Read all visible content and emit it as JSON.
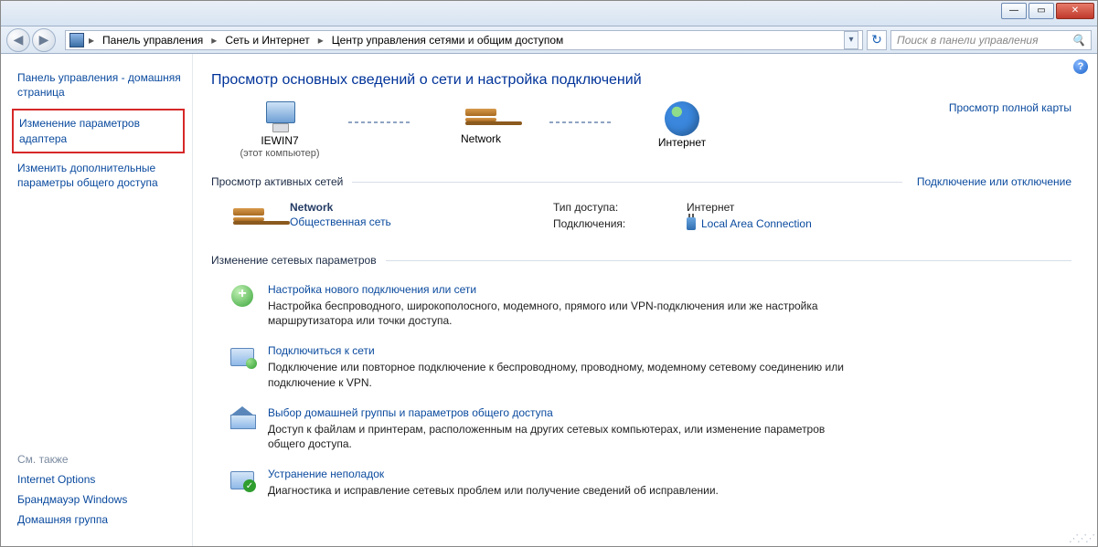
{
  "window": {
    "minimize": "—",
    "maximize": "▭",
    "close": "✕"
  },
  "breadcrumb": {
    "items": [
      "Панель управления",
      "Сеть и Интернет",
      "Центр управления сетями и общим доступом"
    ],
    "sep": "▸"
  },
  "search": {
    "placeholder": "Поиск в панели управления"
  },
  "sidebar": {
    "home": "Панель управления - домашняя страница",
    "adapter": "Изменение параметров адаптера",
    "advanced": "Изменить дополнительные параметры общего доступа"
  },
  "see_also": {
    "header": "См. также",
    "links": [
      "Internet Options",
      "Брандмауэр Windows",
      "Домашняя группа"
    ]
  },
  "main": {
    "title": "Просмотр основных сведений о сети и настройка подключений",
    "map": {
      "node1": "IEWIN7",
      "node1_sub": "(этот компьютер)",
      "node2": "Network",
      "node3": "Интернет",
      "full_map": "Просмотр полной карты"
    },
    "active_hdr": "Просмотр активных сетей",
    "active_link": "Подключение или отключение",
    "net": {
      "name": "Network",
      "type": "Общественная сеть",
      "access_lbl": "Тип доступа:",
      "access_val": "Интернет",
      "conn_lbl": "Подключения:",
      "conn_val": "Local Area Connection"
    },
    "change_hdr": "Изменение сетевых параметров",
    "opts": [
      {
        "title": "Настройка нового подключения или сети",
        "desc": "Настройка беспроводного, широкополосного, модемного, прямого или VPN-подключения или же настройка маршрутизатора или точки доступа."
      },
      {
        "title": "Подключиться к сети",
        "desc": "Подключение или повторное подключение к беспроводному, проводному, модемному сетевому соединению или подключение к VPN."
      },
      {
        "title": "Выбор домашней группы и параметров общего доступа",
        "desc": "Доступ к файлам и принтерам, расположенным на других сетевых компьютерах, или изменение параметров общего доступа."
      },
      {
        "title": "Устранение неполадок",
        "desc": "Диагностика и исправление сетевых проблем или получение сведений об исправлении."
      }
    ]
  }
}
